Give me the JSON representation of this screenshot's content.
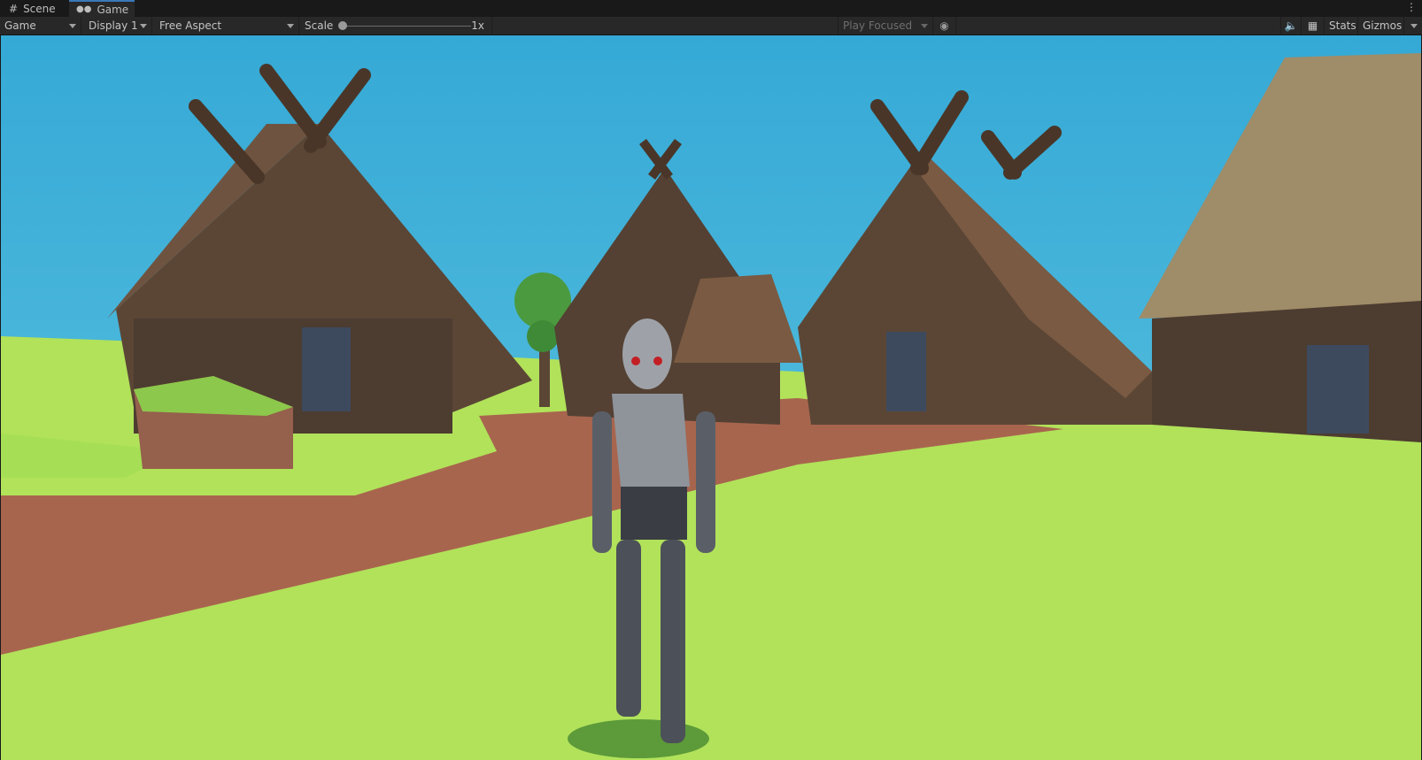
{
  "tabs": [
    {
      "label": "Scene",
      "icon": "grid-icon"
    },
    {
      "label": "Game",
      "icon": "gamepad-icon",
      "active": true
    }
  ],
  "toolbar": {
    "view_select": "Game",
    "display_select": "Display 1",
    "aspect_select": "Free Aspect",
    "scale_label": "Scale",
    "scale_value": "1x",
    "scale_level": 0,
    "play_mode_select": "Play Focused",
    "stats_label": "Stats",
    "gizmos_label": "Gizmos"
  },
  "colors": {
    "sky": "#39b0d9",
    "grass": "#b3e35a",
    "path": "#a8654e",
    "accent": "#3a79bb"
  }
}
